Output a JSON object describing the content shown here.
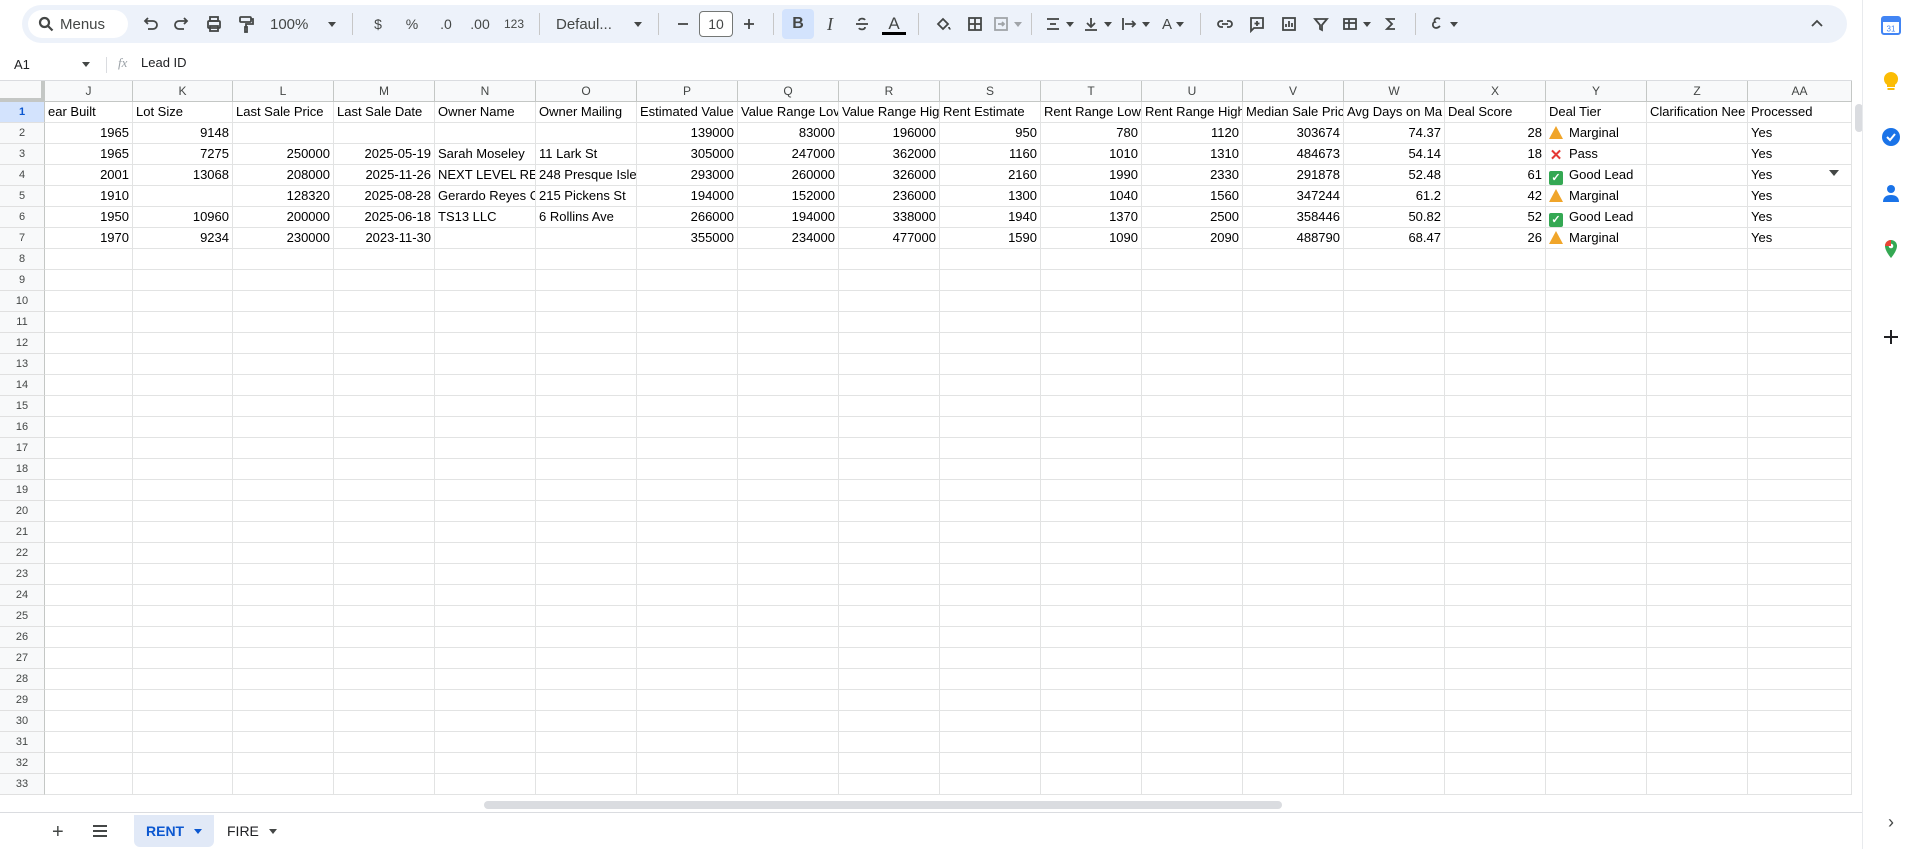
{
  "toolbar": {
    "search_label": "Menus",
    "zoom": "100%",
    "currency": "$",
    "percent": "%",
    "dec_decrease": ".0",
    "dec_increase": ".00",
    "format_number": "123",
    "font": "Defaul...",
    "font_size": "10",
    "bold": "B",
    "italic": "I",
    "font_color_label": "A",
    "text_rotation_label": "A"
  },
  "formula_bar": {
    "cell_ref": "A1",
    "fx": "fx",
    "content": "Lead ID"
  },
  "columns": [
    "J",
    "K",
    "L",
    "M",
    "N",
    "O",
    "P",
    "Q",
    "R",
    "S",
    "T",
    "U",
    "V",
    "W",
    "X",
    "Y",
    "Z",
    "AA"
  ],
  "headers": [
    "ear Built",
    "Lot Size",
    "Last Sale Price",
    "Last Sale Date",
    "Owner Name",
    "Owner Mailing",
    "Estimated Value",
    "Value Range Lov",
    "Value Range Hig",
    "Rent Estimate",
    "Rent Range Low",
    "Rent Range High",
    "Median Sale Pric",
    "Avg Days on Ma",
    "Deal Score",
    "Deal Tier",
    "Clarification Nee",
    "Processed"
  ],
  "rows": [
    [
      "1965",
      "9148",
      "",
      "",
      "",
      "",
      "139000",
      "83000",
      "196000",
      "950",
      "780",
      "1120",
      "303674",
      "74.37",
      "28",
      "Marginal",
      "",
      "Yes"
    ],
    [
      "1965",
      "7275",
      "250000",
      "2025-05-19",
      "Sarah Moseley",
      "11 Lark St",
      "305000",
      "247000",
      "362000",
      "1160",
      "1010",
      "1310",
      "484673",
      "54.14",
      "18",
      "Pass",
      "",
      "Yes"
    ],
    [
      "2001",
      "13068",
      "208000",
      "2025-11-26",
      "NEXT LEVEL RE",
      "248 Presque Isle",
      "293000",
      "260000",
      "326000",
      "2160",
      "1990",
      "2330",
      "291878",
      "52.48",
      "61",
      "Good Lead",
      "",
      "Yes"
    ],
    [
      "1910",
      "",
      "128320",
      "2025-08-28",
      "Gerardo Reyes C",
      "215 Pickens St",
      "194000",
      "152000",
      "236000",
      "1300",
      "1040",
      "1560",
      "347244",
      "61.2",
      "42",
      "Marginal",
      "",
      "Yes"
    ],
    [
      "1950",
      "10960",
      "200000",
      "2025-06-18",
      "TS13 LLC",
      "6 Rollins Ave",
      "266000",
      "194000",
      "338000",
      "1940",
      "1370",
      "2500",
      "358446",
      "50.82",
      "52",
      "Good Lead",
      "",
      "Yes"
    ],
    [
      "1970",
      "9234",
      "230000",
      "2023-11-30",
      "",
      "",
      "355000",
      "234000",
      "477000",
      "1590",
      "1090",
      "2090",
      "488790",
      "68.47",
      "26",
      "Marginal",
      "",
      "Yes"
    ]
  ],
  "tier_icons": {
    "Marginal": "warning-icon",
    "Pass": "cross-icon",
    "Good Lead": "check-icon"
  },
  "row_numbers": [
    "1",
    "2",
    "3",
    "4",
    "5",
    "6",
    "7",
    "8",
    "9",
    "10",
    "11",
    "12",
    "13",
    "14",
    "15",
    "16",
    "17",
    "18",
    "19",
    "20",
    "21",
    "22",
    "23",
    "24",
    "25",
    "26",
    "27",
    "28",
    "29",
    "30",
    "31",
    "32",
    "33"
  ],
  "sheets": [
    {
      "name": "RENT",
      "active": true
    },
    {
      "name": "FIRE",
      "active": false
    }
  ],
  "colors": {
    "accent": "#0b57d0",
    "toolbar_bg": "#edf2fa",
    "selected_bg": "#d3e3fd"
  }
}
